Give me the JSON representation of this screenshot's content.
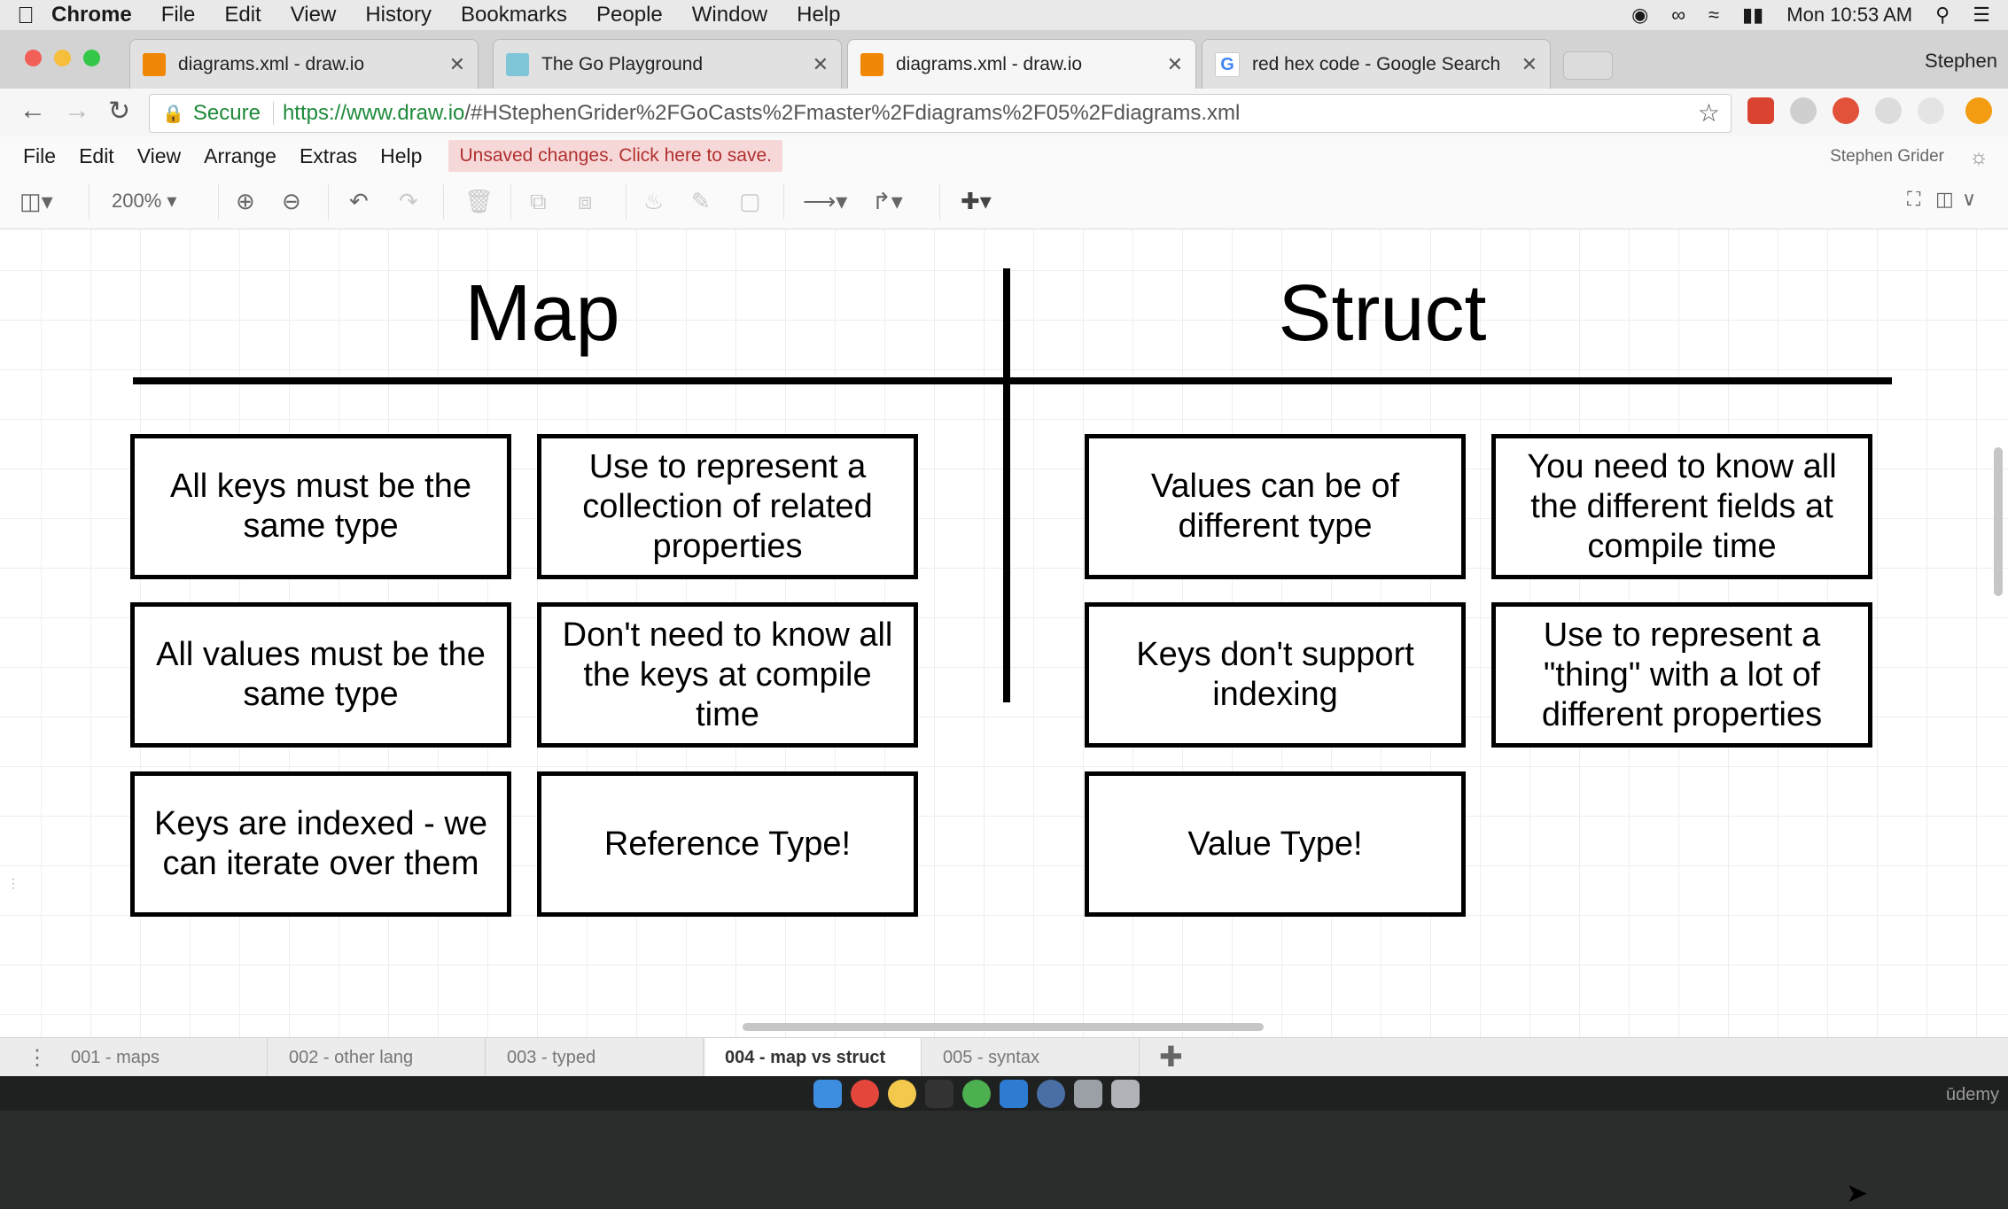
{
  "macos_menu": {
    "items": [
      "Chrome",
      "File",
      "Edit",
      "View",
      "History",
      "Bookmarks",
      "People",
      "Window",
      "Help"
    ],
    "clock": "Mon 10:53 AM"
  },
  "browser": {
    "tabs": [
      {
        "title": "diagrams.xml - draw.io",
        "icon": "drawio-icon"
      },
      {
        "title": "The Go Playground",
        "icon": "go-playground-icon"
      },
      {
        "title": "diagrams.xml - draw.io",
        "icon": "drawio-icon"
      },
      {
        "title": "red hex code - Google Search",
        "icon": "google-icon"
      }
    ],
    "profile_name": "Stephen",
    "secure_label": "Secure",
    "url_host": "https://www.draw.io",
    "url_rest": "/#HStephenGrider%2FGoCasts%2Fmaster%2Fdiagrams%2F05%2Fdiagrams.xml"
  },
  "drawio": {
    "menu": [
      "File",
      "Edit",
      "View",
      "Arrange",
      "Extras",
      "Help"
    ],
    "unsaved_notice": "Unsaved changes. Click here to save.",
    "user": "Stephen Grider",
    "zoom": "200%"
  },
  "diagram": {
    "left_title": "Map",
    "right_title": "Struct",
    "map_boxes": [
      "All keys must be the same type",
      "Use to represent a collection of related properties",
      "All values must be the same type",
      "Don't need to know all the keys at compile time",
      "Keys are indexed - we can iterate over them",
      "Reference Type!"
    ],
    "struct_boxes": [
      "Values can be of different type",
      "You need to know all the different fields at compile time",
      "Keys don't support indexing",
      "Use to represent a \"thing\" with a lot of different properties",
      "Value Type!"
    ]
  },
  "pages": [
    "001 - maps",
    "002 - other lang",
    "003 - typed",
    "004 - map vs struct",
    "005 - syntax"
  ],
  "dock": {
    "watermark": "ūdemy"
  }
}
